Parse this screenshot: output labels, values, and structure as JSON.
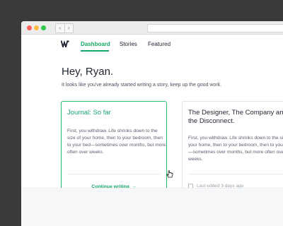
{
  "nav": {
    "items": [
      {
        "label": "Dashboard",
        "active": true
      },
      {
        "label": "Stories",
        "active": false
      },
      {
        "label": "Featured",
        "active": false
      }
    ]
  },
  "browser": {
    "back_icon": "chevron-left-icon",
    "forward_icon": "chevron-right-icon"
  },
  "greeting": "Hey, Ryan.",
  "subtitle": "It looks like you've already started writing a story, keep up the good work.",
  "cards": [
    {
      "title": "Journal: So far",
      "excerpt": "First, you withdraw. Life shrinks down to the size of your home, then to your bedroom, then to your bed—sometimes over months, but more often over weeks.",
      "action_label": "Continue writing",
      "action_icon": "arrow-right-icon"
    },
    {
      "title": "The Designer, The Company and the Disconnect.",
      "excerpt": "First, you withdraw. Life shrinks down to the size of your home, then to your bedroom, then to your bed—sometimes over months, but more often over weeks.",
      "meta": "Last edited 3 days ago",
      "meta_icon": "document-icon"
    }
  ],
  "colors": {
    "accent": "#17a86a",
    "background": "#3a3a3a",
    "text": "#1f2430"
  }
}
